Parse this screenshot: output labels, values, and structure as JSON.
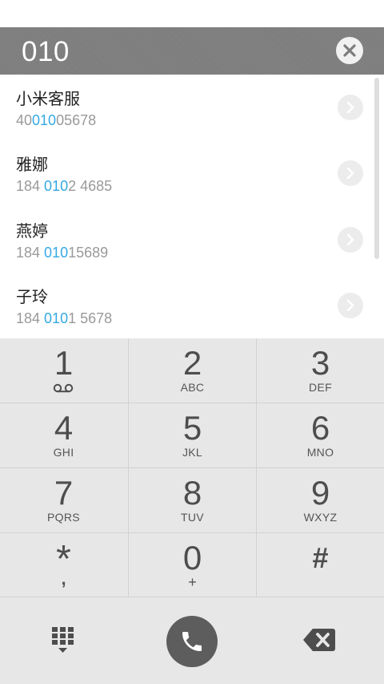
{
  "search": {
    "query": "010"
  },
  "results": [
    {
      "name": "小米客服",
      "number_pre": "40",
      "number_match": "010",
      "number_post": "05678"
    },
    {
      "name": "雅娜",
      "number_pre": "184 ",
      "number_match": "010",
      "number_post": "2 4685"
    },
    {
      "name": "燕婷",
      "number_pre": "184 ",
      "number_match": "010",
      "number_post": "15689"
    },
    {
      "name": "子玲",
      "number_pre": "184 ",
      "number_match": "010",
      "number_post": "1 5678"
    }
  ],
  "keypad": [
    {
      "digit": "1",
      "letters": "",
      "icon": "voicemail-icon"
    },
    {
      "digit": "2",
      "letters": "ABC"
    },
    {
      "digit": "3",
      "letters": "DEF"
    },
    {
      "digit": "4",
      "letters": "GHI"
    },
    {
      "digit": "5",
      "letters": "JKL"
    },
    {
      "digit": "6",
      "letters": "MNO"
    },
    {
      "digit": "7",
      "letters": "PQRS"
    },
    {
      "digit": "8",
      "letters": "TUV"
    },
    {
      "digit": "9",
      "letters": "WXYZ"
    },
    {
      "digit": "*",
      "letters": ","
    },
    {
      "digit": "0",
      "letters": "+"
    },
    {
      "digit": "#",
      "letters": ""
    }
  ],
  "bottom": {
    "left_icon": "dialpad-icon",
    "center_icon": "phone-icon",
    "right_icon": "backspace-icon"
  },
  "colors": {
    "search_bg": "#7d7d7d",
    "highlight": "#35a9e3",
    "keypad_bg": "#e7e7e7",
    "call_button": "#5d5d5d"
  }
}
